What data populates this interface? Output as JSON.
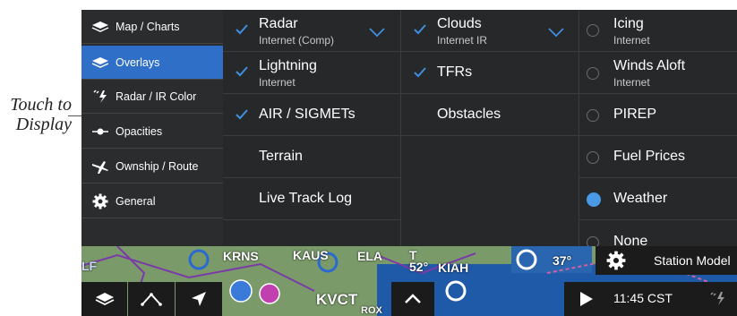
{
  "callout": {
    "line1": "Touch to",
    "line2": "Display"
  },
  "sidebar": {
    "items": [
      {
        "label": "Map / Charts",
        "icon": "layers-icon",
        "active": false
      },
      {
        "label": "Overlays",
        "icon": "layers-icon",
        "active": true
      },
      {
        "label": "Radar / IR Color",
        "icon": "lightning-icon",
        "active": false
      },
      {
        "label": "Opacities",
        "icon": "slider-icon",
        "active": false
      },
      {
        "label": "Ownship / Route",
        "icon": "airplane-route-icon",
        "active": false
      },
      {
        "label": "General",
        "icon": "gear-icon",
        "active": false
      }
    ]
  },
  "columns": {
    "col1": [
      {
        "title": "Radar",
        "sub": "Internet (Comp)",
        "checked": true,
        "expand": true
      },
      {
        "title": "Lightning",
        "sub": "Internet",
        "checked": true
      },
      {
        "title": "AIR / SIGMETs",
        "checked": true
      },
      {
        "title": "Terrain",
        "checked": false
      },
      {
        "title": "Live Track Log",
        "checked": false
      }
    ],
    "col2": [
      {
        "title": "Clouds",
        "sub": "Internet IR",
        "checked": true,
        "expand": true
      },
      {
        "title": "TFRs",
        "checked": true
      },
      {
        "title": "Obstacles",
        "checked": false
      }
    ],
    "col3": [
      {
        "title": "Icing",
        "sub": "Internet",
        "selected": false
      },
      {
        "title": "Winds Aloft",
        "sub": "Internet",
        "selected": false
      },
      {
        "title": "PIREP",
        "selected": false
      },
      {
        "title": "Fuel Prices",
        "selected": false
      },
      {
        "title": "Weather",
        "selected": true
      },
      {
        "title": "None",
        "selected": false
      }
    ]
  },
  "map": {
    "labels": [
      "LF",
      "KRNS",
      "KAUS",
      "ELA",
      "T",
      "52°",
      "KIAH",
      "37°",
      "KVCT",
      "ROX"
    ]
  },
  "toolbar": {
    "station_model": "Station Model",
    "time": "11:45 CST"
  },
  "colors": {
    "accent": "#2f6fc8",
    "check": "#3f8fe0",
    "radio_on": "#4a9ae8"
  }
}
